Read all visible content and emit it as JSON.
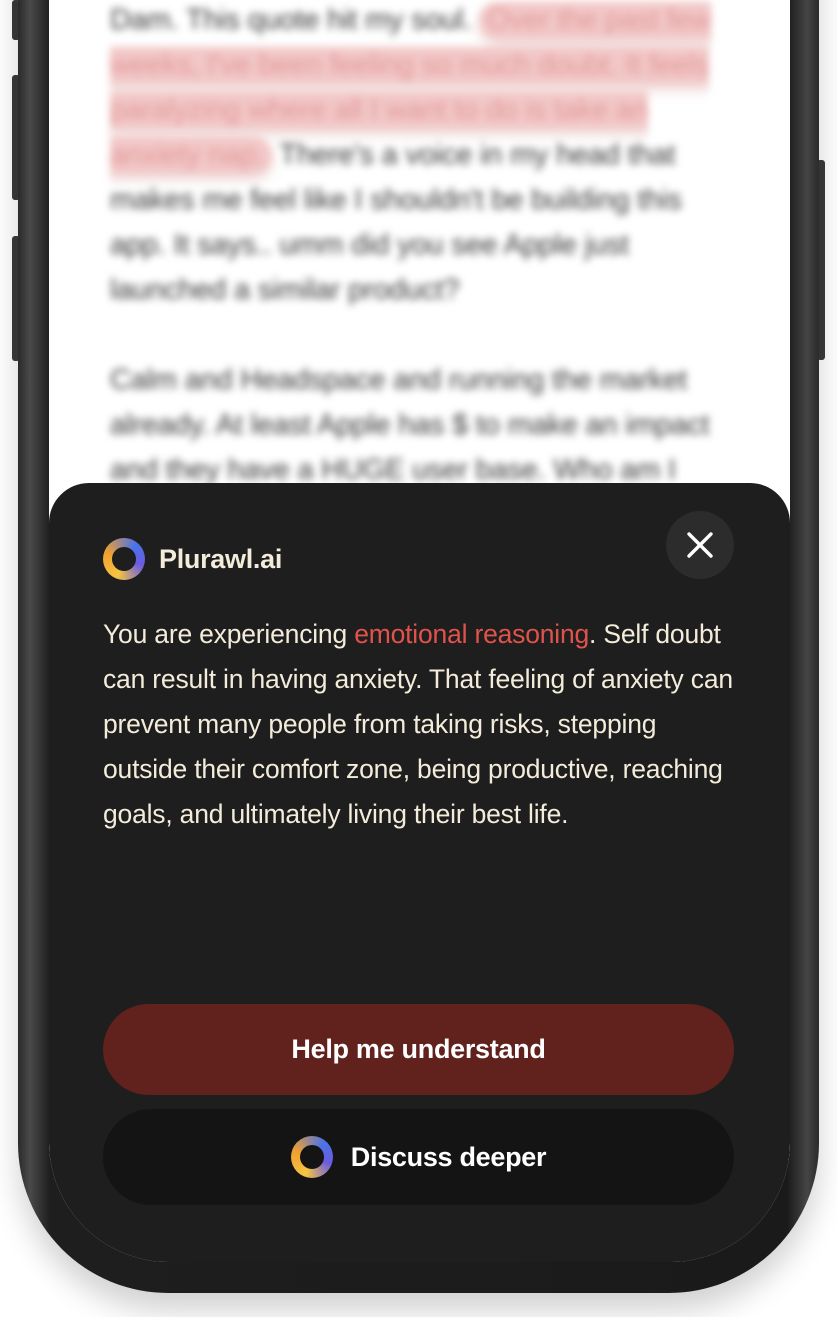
{
  "journal": {
    "line_1_plain": "Dam. This quote hit my soul.",
    "highlight_1": "Over the past few weeks, I've been feeling so much doubt. It feels paralyzing where all I want to do is take an anxiety nap.",
    "line_1_rest": "There's a voice in my head that makes me feel like I shouldn't be building this app. It says.. umm did you see Apple just launched a similar product?",
    "paragraph_2": "Calm and Headspace and running the market already. At least Apple has $ to make an impact and they have a HUGE user base. Who am I thought to think that I can enter this crowded"
  },
  "sheet": {
    "brand_name": "Plurawl.ai",
    "brand_icon": "plurawl-ring-logo",
    "close_icon": "close-icon",
    "insight_prefix": "You are experiencing ",
    "insight_highlight": "emotional reasoning",
    "insight_suffix": ". Self doubt can result in having anxiety. That feeling of anxiety can prevent many people from taking risks, stepping outside their comfort zone, being productive, reaching goals, and ultimately living their best life.",
    "primary_button_label": "Help me understand",
    "secondary_button_label": "Discuss deeper"
  },
  "colors": {
    "sheet_bg": "#1e1e1f",
    "accent_text": "#e0534b",
    "primary_button_bg": "#61211d",
    "secondary_button_bg": "#141414",
    "highlight_bg": "#f2c7c7",
    "body_text": "#f4ecda"
  }
}
